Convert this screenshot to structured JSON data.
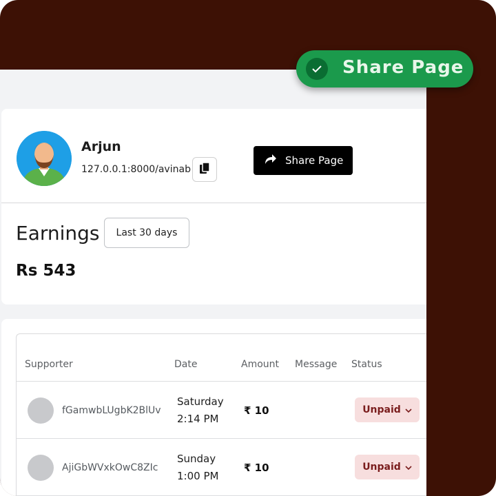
{
  "profile": {
    "name": "Arjun",
    "url": "127.0.0.1:8000/avinab",
    "share_label": "Share Page"
  },
  "earnings": {
    "title": "Earnings",
    "range_label": "Last 30 days",
    "total": "Rs 543"
  },
  "table": {
    "headers": [
      "Supporter",
      "Date",
      "Amount",
      "Message",
      "Status"
    ],
    "rows": [
      {
        "supporter": "fGamwbLUgbK2BlUv",
        "day": "Saturday",
        "time": "2:14 PM",
        "amount": "₹ 10",
        "message": "",
        "status": "Unpaid"
      },
      {
        "supporter": "AjiGbWVxkOwC8ZIc",
        "day": "Sunday",
        "time": "1:00 PM",
        "amount": "₹ 10",
        "message": "",
        "status": "Unpaid"
      }
    ]
  },
  "toast": {
    "label": "Share Page"
  },
  "colors": {
    "background": "#3d1105",
    "toast": "#1b9a4c",
    "status_badge": "#f7dede"
  }
}
